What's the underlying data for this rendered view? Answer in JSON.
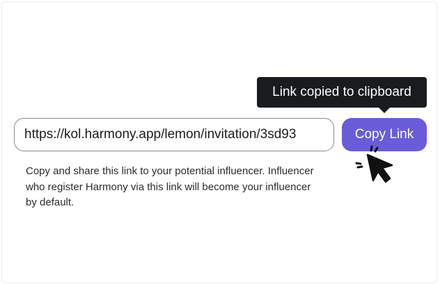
{
  "tooltip": {
    "text": "Link copied to clipboard"
  },
  "invite": {
    "link_value": "https://kol.harmony.app/lemon/invitation/3sd93",
    "copy_button_label": "Copy Link",
    "helper_text": "Copy and share this link to your potential influencer. Influencer who register Harmony via this link will become your influencer by default."
  },
  "icons": {
    "cursor": "pointer-cursor-icon"
  },
  "colors": {
    "accent": "#6a5cd8",
    "tooltip_bg": "#1a1b1e",
    "input_border": "#8a8a90",
    "text": "#2b2b30"
  }
}
